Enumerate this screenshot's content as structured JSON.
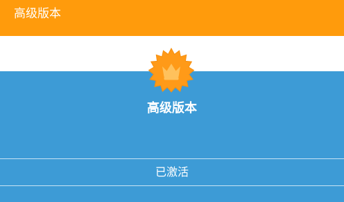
{
  "header": {
    "title": "高级版本"
  },
  "premium": {
    "title": "高级版本",
    "icon": "crown-badge-icon",
    "status": "已激活"
  },
  "colors": {
    "header": "#ff9b0c",
    "panel": "#3d9bd6",
    "badge": "#ff9a18",
    "crown": "#ffc15c"
  }
}
